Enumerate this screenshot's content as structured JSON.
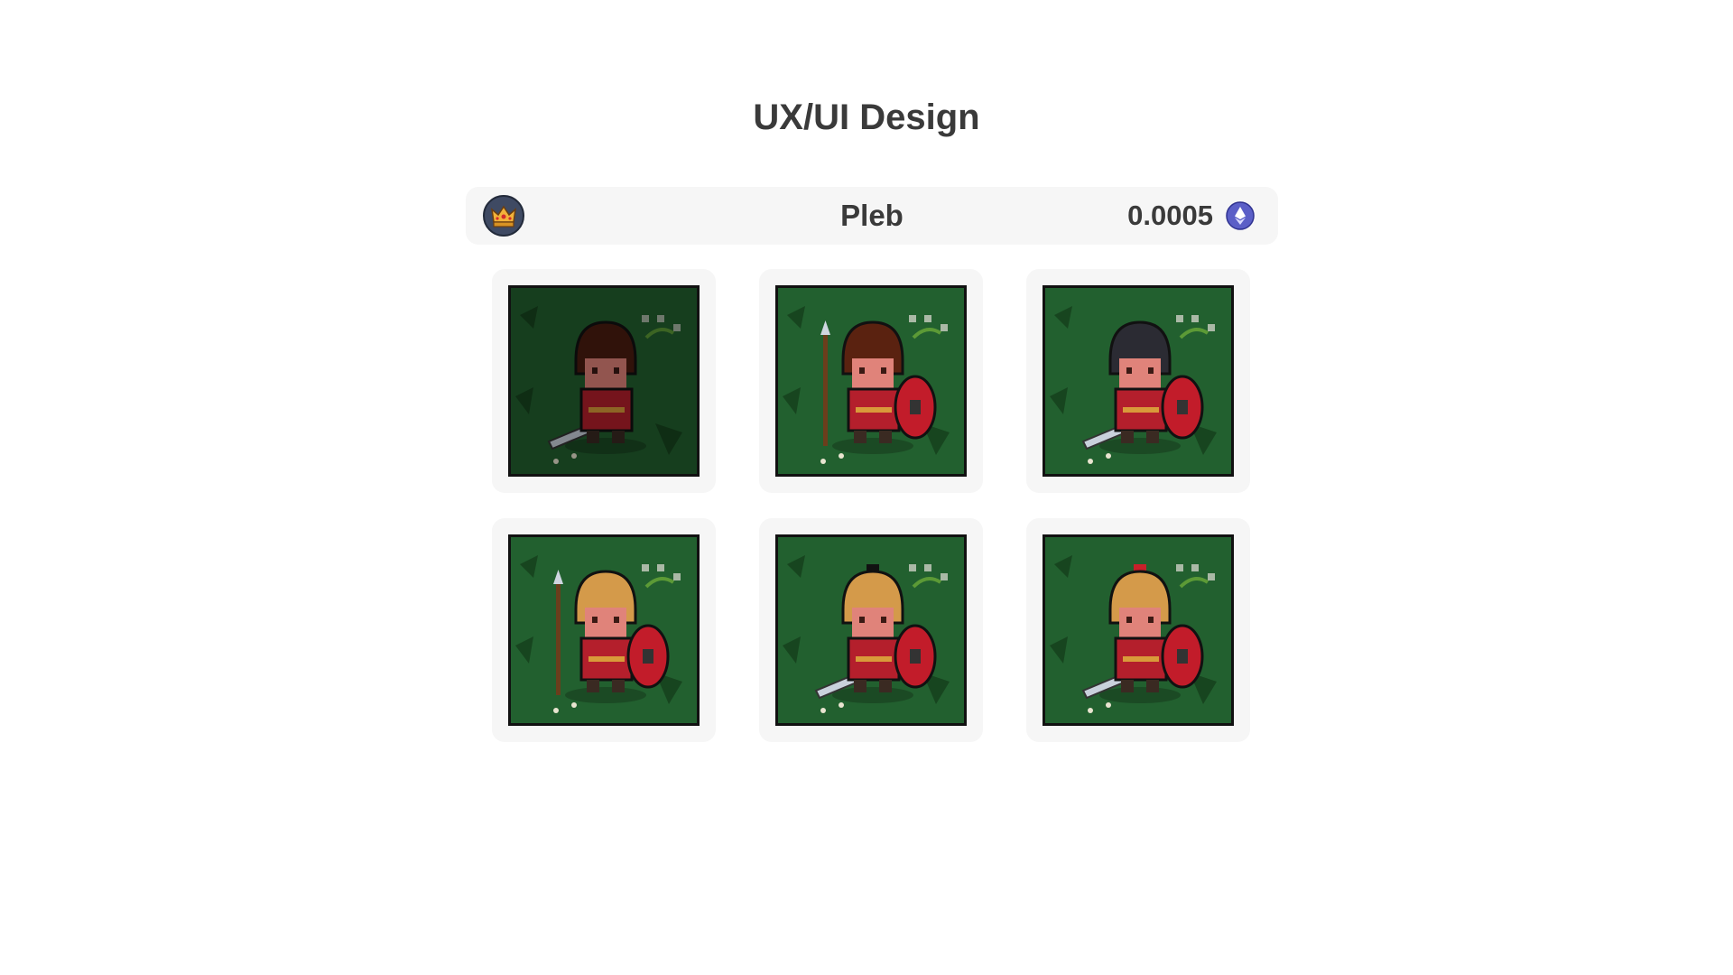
{
  "page": {
    "title": "UX/UI Design"
  },
  "header": {
    "rank_icon": "crown-icon",
    "rank_name": "Pleb",
    "price": "0.0005",
    "currency_icon": "ethereum-icon",
    "colors": {
      "bar": "#f6f6f6",
      "eth": "#5b5fc7"
    }
  },
  "cards": [
    {
      "name": "card-1",
      "figure": "plain-recruit",
      "hair": "#4a1d10",
      "weapon": "sword",
      "shield": false,
      "selected": false,
      "dim": true
    },
    {
      "name": "card-2",
      "figure": "spear-recruit",
      "hair": "#5a2210",
      "weapon": "spear",
      "shield": true,
      "selected": false,
      "dim": false
    },
    {
      "name": "card-3",
      "figure": "dark-helmet",
      "hair": "#2a2a30",
      "weapon": "sword",
      "shield": true,
      "selected": false,
      "dim": false
    },
    {
      "name": "card-4",
      "figure": "gold-helmet-spear",
      "hair": "#d8a35a",
      "weapon": "spear",
      "shield": true,
      "selected": false,
      "dim": false
    },
    {
      "name": "card-5",
      "figure": "gold-helmet-black-crest",
      "hair": "#d8a35a",
      "weapon": "sword",
      "shield": true,
      "selected": false,
      "dim": false
    },
    {
      "name": "card-6",
      "figure": "gold-helmet-red-crest",
      "hair": "#d8a35a",
      "weapon": "sword",
      "shield": true,
      "selected": false,
      "dim": false
    }
  ]
}
